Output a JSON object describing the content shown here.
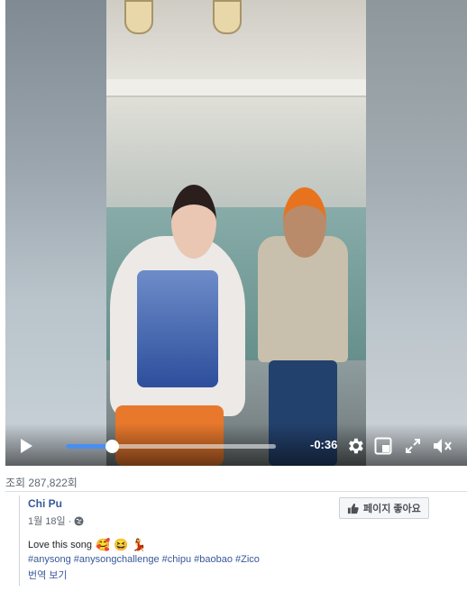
{
  "player": {
    "time_remaining": "-0:36",
    "progress": 0.22,
    "icons": [
      "play-icon",
      "gear-icon",
      "picture-in-picture-icon",
      "fullscreen-icon",
      "volume-muted-icon"
    ]
  },
  "views": "조회 287,822회",
  "post": {
    "author": "Chi Pu",
    "date": "1월 18일 ·",
    "like_page_label": "페이지 좋아요",
    "caption_text": "Love this song",
    "caption_emojis": [
      "🥰",
      "😆",
      "💃"
    ],
    "hashtags": [
      "#anysong",
      "#anysongchallenge",
      "#chipu",
      "#baobao",
      "#Zico"
    ],
    "translate_label": "번역 보기"
  },
  "colors": {
    "accent": "#4a8df0",
    "link": "#385898",
    "muted": "#606770"
  }
}
